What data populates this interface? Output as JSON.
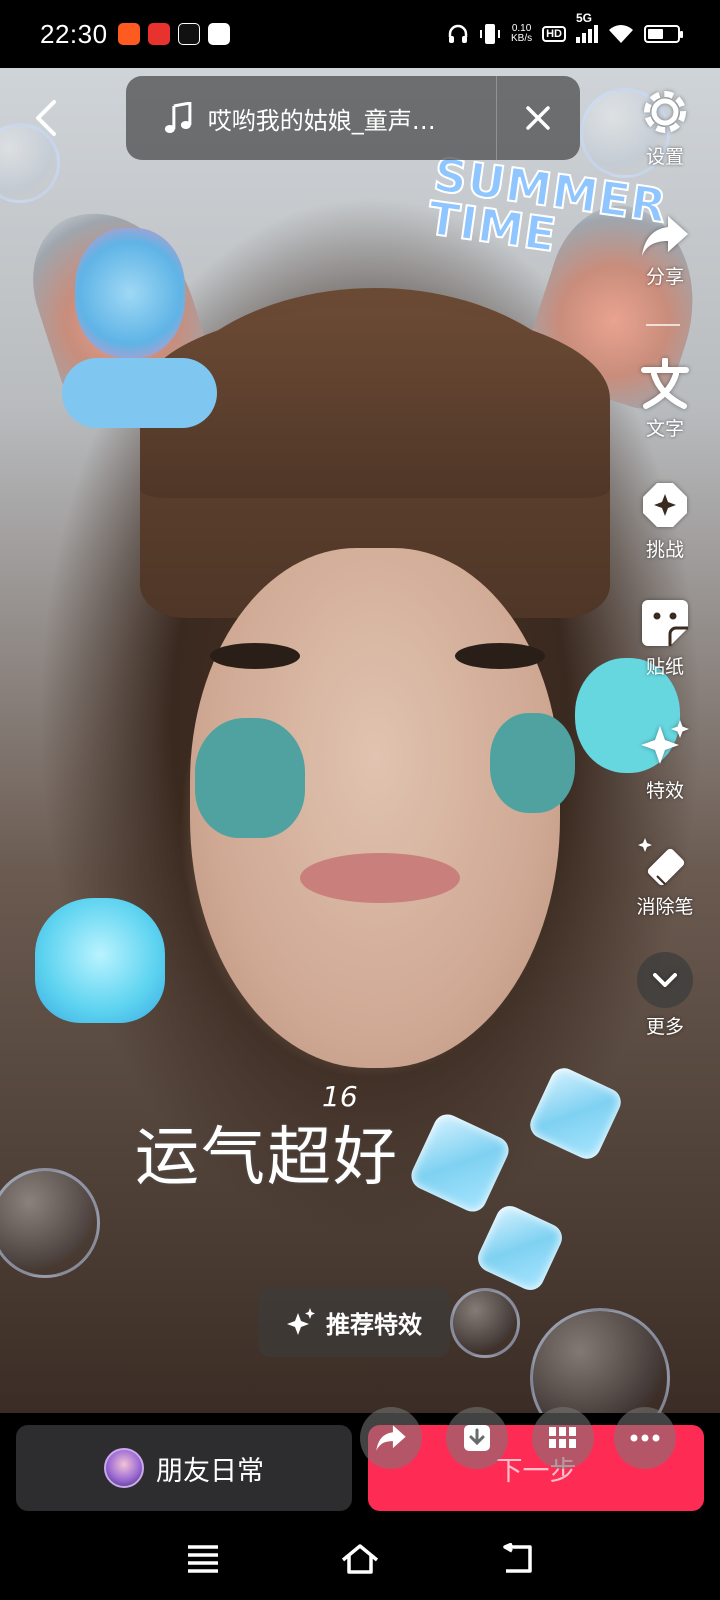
{
  "status_bar": {
    "time": "22:30",
    "net_speed_value": "0.10",
    "net_speed_unit": "KB/s",
    "hd_badge": "HD",
    "network_type": "5G",
    "battery_level": 0.55
  },
  "music": {
    "title": "哎哟我的姑娘_童声…"
  },
  "overlay": {
    "sticker_text": "运气超好",
    "sticker_number": "16",
    "summer_line1": "SUMMER",
    "summer_line2": "TIME"
  },
  "tools": [
    {
      "name": "settings",
      "label": "设置",
      "icon": "gear-icon"
    },
    {
      "name": "share",
      "label": "分享",
      "icon": "share-arrow-icon"
    },
    {
      "name": "text",
      "label": "文字",
      "icon": "text-icon"
    },
    {
      "name": "challenge",
      "label": "挑战",
      "icon": "challenge-icon"
    },
    {
      "name": "sticker",
      "label": "贴纸",
      "icon": "sticker-icon"
    },
    {
      "name": "effects",
      "label": "特效",
      "icon": "sparkle-icon"
    },
    {
      "name": "eraser",
      "label": "消除笔",
      "icon": "eraser-icon"
    },
    {
      "name": "more",
      "label": "更多",
      "icon": "chevron-down-icon"
    }
  ],
  "recommend_effects": "推荐特效",
  "bottom": {
    "daily_label": "朋友日常",
    "next_label": "下一步"
  },
  "colors": {
    "primary_red": "#fe2c55",
    "dark_button": "#2d2d2f"
  }
}
